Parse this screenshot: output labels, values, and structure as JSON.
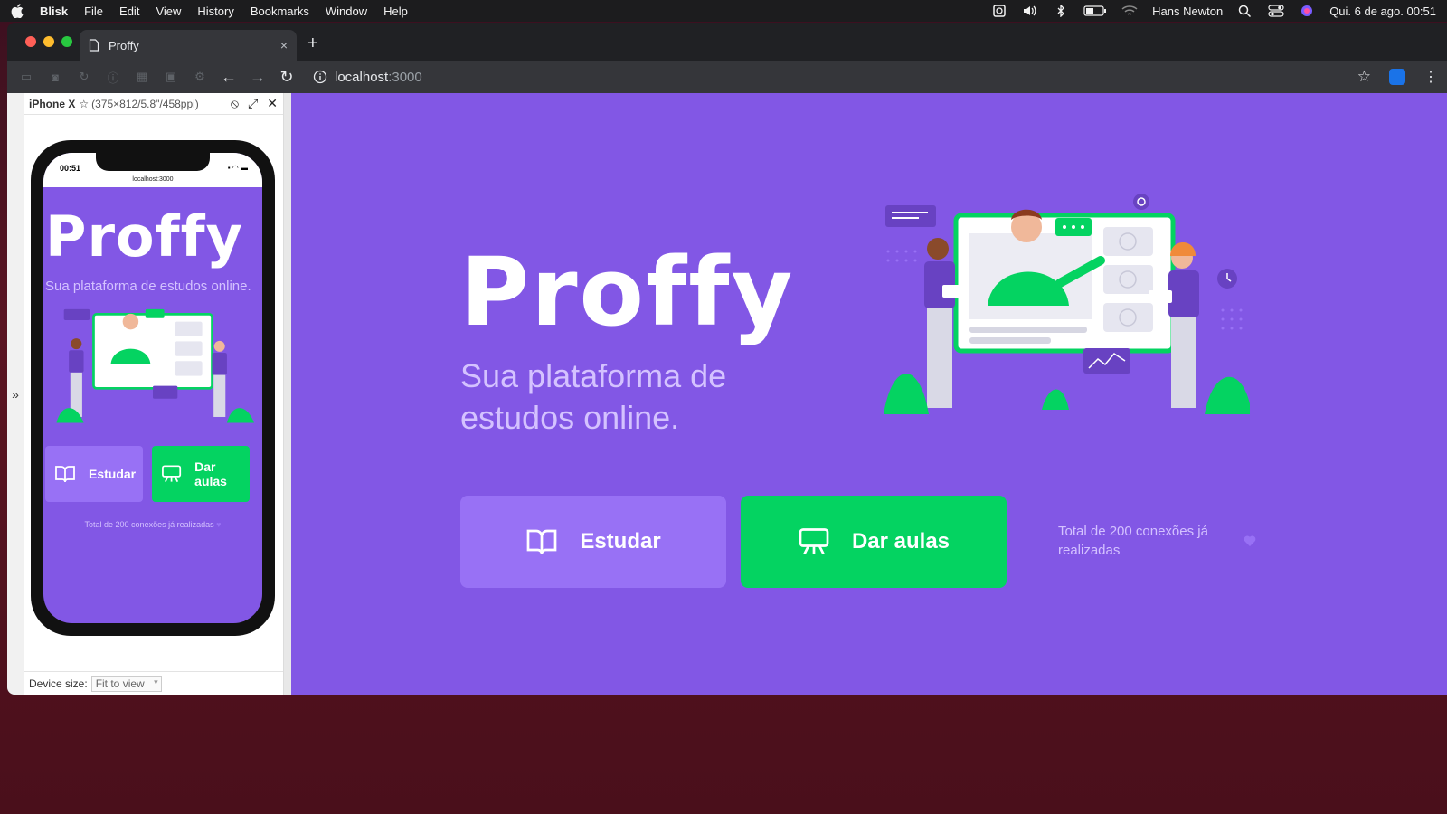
{
  "menubar": {
    "app": "Blisk",
    "items": [
      "File",
      "Edit",
      "View",
      "History",
      "Bookmarks",
      "Window",
      "Help"
    ],
    "user": "Hans Newton",
    "clock": "Qui. 6 de ago.  00:51"
  },
  "browser": {
    "tab_title": "Proffy",
    "tab_close": "×",
    "new_tab": "+",
    "url_host": "localhost",
    "url_port": ":3000"
  },
  "device_panel": {
    "device_name": "iPhone X",
    "device_spec": "(375×812/5.8\"/458ppi)",
    "device_size_label": "Device size:",
    "device_size_value": "Fit to view",
    "expand_glyph": "»"
  },
  "phone": {
    "time": "00:51",
    "url": "localhost:3000"
  },
  "landing": {
    "logo": "Proffy",
    "subtitle": "Sua plataforma de estudos online.",
    "study_label": "Estudar",
    "teach_label": "Dar aulas",
    "total_connections": "Total de 200 conexões já realizadas"
  },
  "colors": {
    "primary": "#8257e5",
    "primary_lighter": "#9871f5",
    "secondary": "#04d361",
    "text_light": "#d4c2ff"
  },
  "icons": {
    "study": "book-open-icon",
    "teach": "presentation-icon",
    "heart": "heart-icon"
  }
}
